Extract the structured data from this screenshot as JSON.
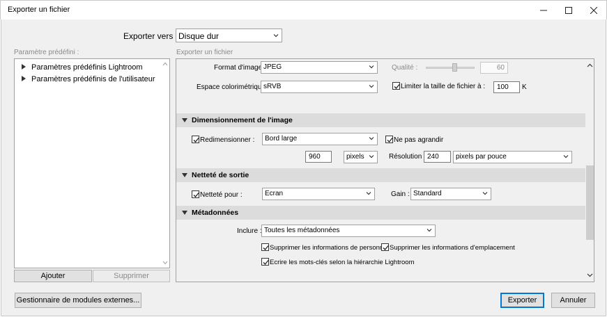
{
  "window": {
    "title": "Exporter un fichier",
    "minimize_icon": "minimize-icon",
    "maximize_icon": "maximize-icon",
    "close_icon": "close-icon"
  },
  "export_to": {
    "label": "Exporter vers :",
    "value": "Disque dur"
  },
  "left_panel": {
    "label": "Paramètre prédéfini :",
    "items": [
      {
        "label": "Paramètres prédéfinis Lightroom"
      },
      {
        "label": "Paramètres prédéfinis de l'utilisateur"
      }
    ],
    "add_button": "Ajouter",
    "remove_button": "Supprimer"
  },
  "right_panel": {
    "label": "Exporter un fichier"
  },
  "file_settings": {
    "format_label": "Format d'image :",
    "format_value": "JPEG",
    "quality_label": "Qualité :",
    "quality_value": "60",
    "quality_level": 0.6,
    "colorspace_label": "Espace colorimétrique :",
    "colorspace_value": "sRVB",
    "limit_label": "Limiter la taille de fichier à :",
    "limit_value": "100",
    "limit_unit": "K",
    "limit_checked": true
  },
  "sizing": {
    "header": "Dimensionnement de l'image",
    "resize_label": "Redimensionner :",
    "resize_checked": true,
    "resize_value": "Bord large",
    "no_enlarge_label": "Ne pas agrandir",
    "no_enlarge_checked": true,
    "size_value": "960",
    "size_unit": "pixels",
    "resolution_label": "Résolution :",
    "resolution_value": "240",
    "resolution_unit": "pixels par pouce"
  },
  "sharpening": {
    "header": "Netteté de sortie",
    "sharpen_label": "Netteté pour :",
    "sharpen_checked": true,
    "sharpen_value": "Ecran",
    "gain_label": "Gain :",
    "gain_value": "Standard"
  },
  "metadata": {
    "header": "Métadonnées",
    "include_label": "Inclure :",
    "include_value": "Toutes les métadonnées",
    "remove_person_label": "Supprimer les informations de personne",
    "remove_location_label": "Supprimer les informations d'emplacement",
    "hierarchy_label": "Ecrire les mots-clés selon la hiérarchie Lightroom"
  },
  "footer": {
    "plugin_manager_button": "Gestionnaire de modules externes...",
    "export_button": "Exporter",
    "cancel_button": "Annuler"
  },
  "colors": {
    "accent": "#0078d7",
    "section_bg": "#dcdcdc",
    "client_bg": "#f0f0f0"
  }
}
